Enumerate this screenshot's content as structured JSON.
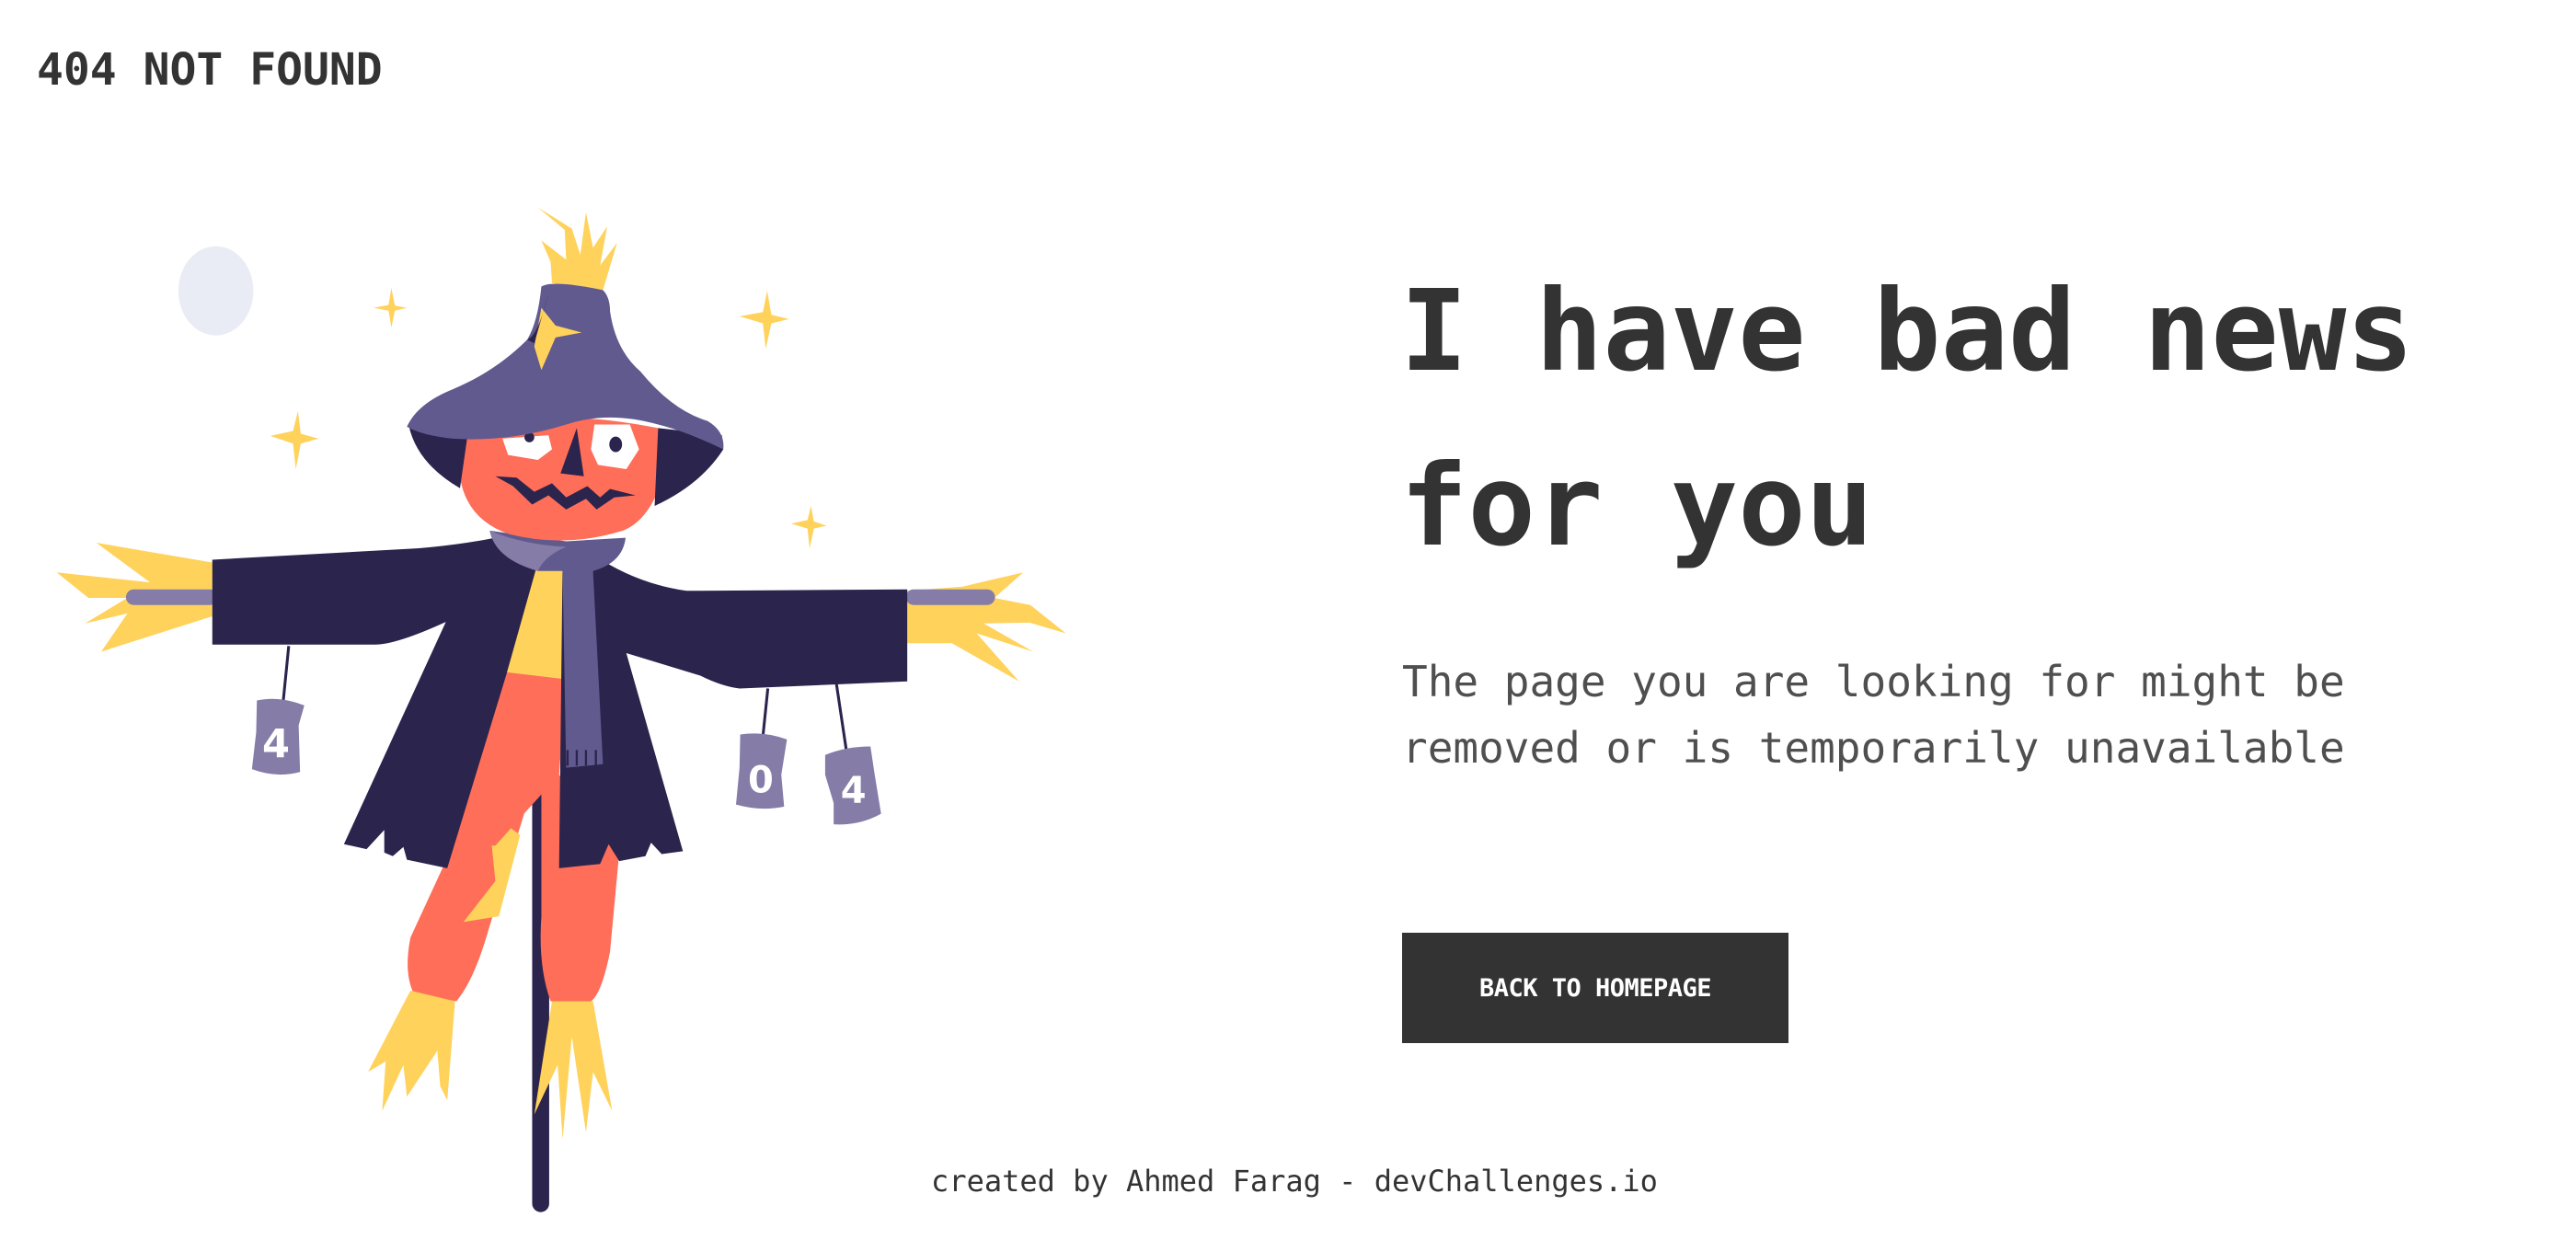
{
  "header": {
    "title": "404 NOT FOUND"
  },
  "illustration": {
    "subject": "scarecrow",
    "cans": [
      "4",
      "0",
      "4"
    ]
  },
  "main": {
    "headline": "I have bad news for you",
    "description": "The page you are looking for might be removed or is temporarily unavailable",
    "button_label": "BACK TO HOMEPAGE"
  },
  "footer": {
    "credit": "created by Ahmed Farag - devChallenges.io"
  },
  "colors": {
    "text": "#333333",
    "button_bg": "#333333",
    "button_text": "#ffffff",
    "coat": "#2b244d",
    "hat": "#615a8e",
    "pumpkin": "#ff6e59",
    "straw": "#ffd25c",
    "moon": "#e9ecf5"
  }
}
